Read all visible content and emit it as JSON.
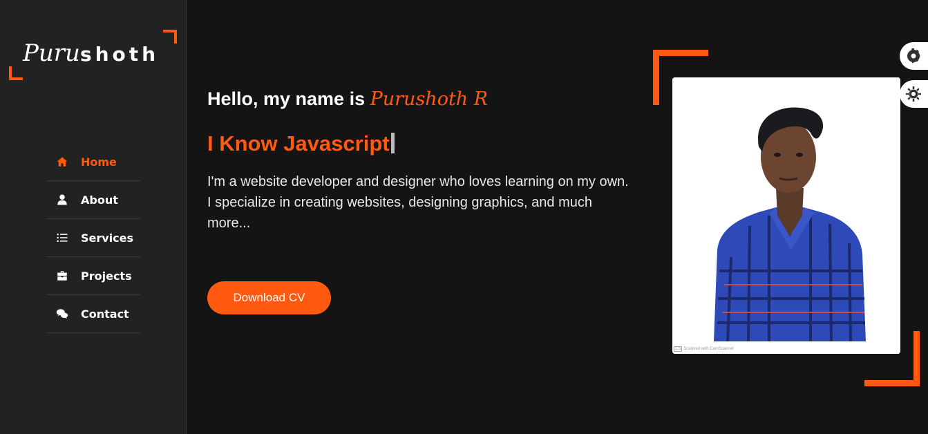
{
  "logo": {
    "script_part": "Puru",
    "bold_part": "shoth"
  },
  "nav": {
    "items": [
      {
        "label": "Home",
        "icon": "home-icon",
        "active": true
      },
      {
        "label": "About",
        "icon": "user-icon",
        "active": false
      },
      {
        "label": "Services",
        "icon": "list-icon",
        "active": false
      },
      {
        "label": "Projects",
        "icon": "briefcase-icon",
        "active": false
      },
      {
        "label": "Contact",
        "icon": "comments-icon",
        "active": false
      }
    ]
  },
  "hero": {
    "greeting": "Hello, my name is ",
    "name": "Purushoth R",
    "headline": "I Know Javascript",
    "bio": "I'm a website developer and designer who loves learning on my own. I specialize in creating websites, designing graphics, and much more...",
    "cv_button": "Download CV"
  },
  "photo": {
    "watermark_badge": "CS",
    "watermark_text": "Scanned with CamScanner"
  },
  "floating": {
    "settings_icon": "gear-icon",
    "theme_icon": "sun-icon"
  },
  "colors": {
    "accent": "#ff5a0f",
    "background": "#151415",
    "sidebar": "#222222"
  }
}
